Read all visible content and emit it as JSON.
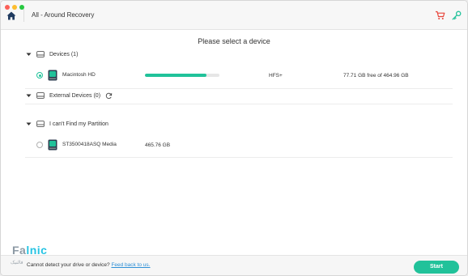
{
  "app": {
    "title": "All - Around Recovery"
  },
  "heading": "Please select a device",
  "sections": {
    "devices": {
      "label": "Devices (1)"
    },
    "external": {
      "label": "External Devices (0)"
    },
    "partition": {
      "label": "I can't Find my Partition"
    }
  },
  "disks": [
    {
      "name": "Macintosh HD",
      "usage_fraction": 0.83,
      "filesystem": "HFS+",
      "free_text": "77.71 GB free of 464.96 GB",
      "selected": true
    },
    {
      "name": "ST3500418ASQ Media",
      "size_text": "465.76 GB",
      "selected": false
    }
  ],
  "footer": {
    "prompt": "Cannot detect your drive or device?",
    "link": "Feed back to us.",
    "start_label": "Start"
  },
  "watermark": {
    "part1": "Fa",
    "part2": "lnic",
    "sub": "فالنیک"
  },
  "colors": {
    "accent": "#21c29a",
    "cart": "#e8443a",
    "link": "#2d8fd6",
    "title_bar": "#f7f7f7"
  },
  "icons": [
    "home-icon",
    "cart-icon",
    "key-icon",
    "chevron-down-icon",
    "drive-icon",
    "refresh-icon",
    "disk-icon"
  ]
}
